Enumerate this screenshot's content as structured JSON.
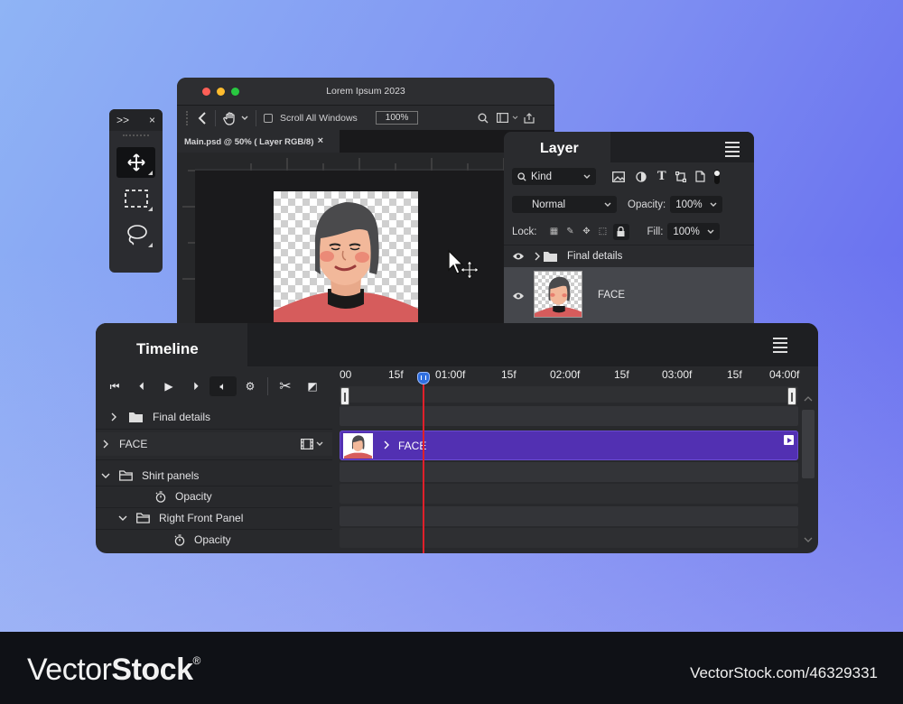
{
  "window": {
    "title": "Lorem Ipsum 2023",
    "scroll_all_windows": "Scroll All Windows",
    "zoom": "100%",
    "doc_tab": "Main.psd @ 50% ( Layer RGB/8)",
    "doc_tab_close": "×"
  },
  "tools": {
    "expand": ">>",
    "close": "×"
  },
  "layer_panel": {
    "title": "Layer",
    "filter_kind": "Kind",
    "blend_mode": "Normal",
    "opacity_label": "Opacity:",
    "opacity_value": "100%",
    "lock_label": "Lock:",
    "fill_label": "Fill:",
    "fill_value": "100%",
    "layers": [
      {
        "name": "Final details"
      },
      {
        "name": "FACE"
      }
    ]
  },
  "timeline": {
    "title": "Timeline",
    "ruler": [
      "00",
      "15f",
      "01:00f",
      "15f",
      "02:00f",
      "15f",
      "03:00f",
      "15f",
      "04:00f"
    ],
    "rows": [
      {
        "label": "Final details"
      },
      {
        "label": "FACE"
      },
      {
        "label": "Shirt panels"
      },
      {
        "label": "Opacity"
      },
      {
        "label": "Right Front Panel"
      },
      {
        "label": "Opacity"
      }
    ],
    "clip_label": "FACE"
  },
  "footer": {
    "brand_regular": "Vector",
    "brand_bold": "Stock",
    "brand_mark": "®",
    "url": "VectorStock.com/46329331"
  },
  "colors": {
    "accent_clip": "#5230b2",
    "playhead": "#e0202a",
    "panel_bg": "#2a2b2e"
  }
}
